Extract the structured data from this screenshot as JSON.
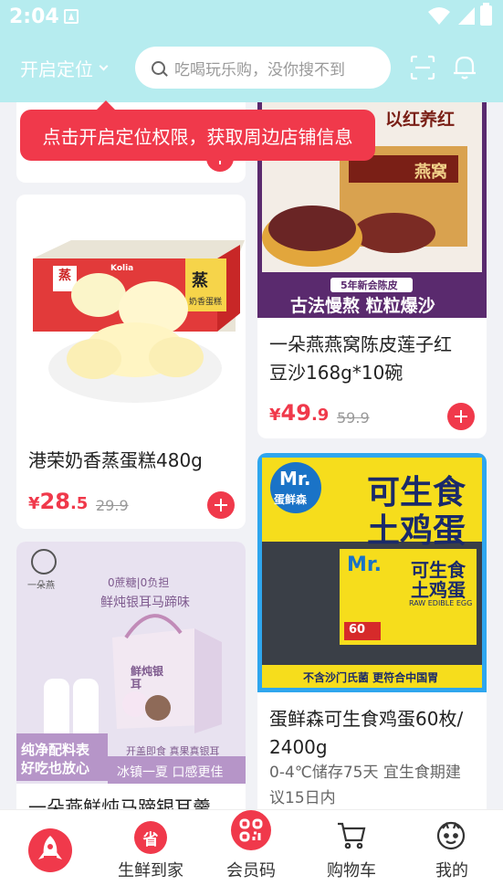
{
  "status_bar": {
    "time": "2:04"
  },
  "header": {
    "location_label": "开启定位",
    "search_placeholder": "吃喝玩乐购，没你搜不到"
  },
  "tooltip": {
    "text": "点击开启定位权限，获取周边店铺信息"
  },
  "products": [
    {
      "image_text": [
        "蒸",
        "奶香蛋糕",
        "Kolia"
      ],
      "title": "港荣奶香蒸蛋糕480g",
      "price_currency": "¥",
      "price_int": "28",
      "price_dec": ".5",
      "old_price": "29.9"
    },
    {
      "image_text": [
        "一朵燕",
        "0蔗糖|0负担",
        "鲜炖银耳马蹄味",
        "纯净配料表",
        "好吃也放心",
        "开盖即食 真果真银耳",
        "冰镇一夏 口感更佳",
        "鲜炖银耳"
      ],
      "title": "一朵燕鲜炖马蹄银耳羹"
    },
    {
      "image_text": [
        "以红养红",
        "燕窝",
        "5年新会陈皮",
        "古法慢熬 粒粒爆沙"
      ],
      "title": "一朵燕燕窝陈皮莲子红豆沙168g*10碗",
      "title_lines": [
        "一朵燕燕窝陈皮莲子红",
        "豆沙168g*10碗"
      ],
      "price_currency": "¥",
      "price_int": "49",
      "price_dec": ".9",
      "old_price": "59.9"
    },
    {
      "image_text": [
        "Mr.",
        "蛋鲜森",
        "可生食",
        "土鸡蛋",
        "RAW EDIBLE EGG",
        "60",
        "不含沙门氏菌 更符合中国胃"
      ],
      "title_lines": [
        "蛋鲜森可生食鸡蛋60枚/",
        "2400g"
      ],
      "subtitle_lines": [
        "0-4℃储存75天 宜生食期建",
        "议15日内"
      ]
    }
  ],
  "bottom_nav": [
    {
      "label": "",
      "icon": "rocket-home-icon"
    },
    {
      "label": "生鲜到家",
      "icon": "sheng-icon",
      "glyph": "省"
    },
    {
      "label": "会员码",
      "icon": "qr-code-icon"
    },
    {
      "label": "购物车",
      "icon": "cart-icon"
    },
    {
      "label": "我的",
      "icon": "profile-icon"
    }
  ],
  "colors": {
    "header_bg": "#b6ecef",
    "accent": "#f0394b"
  }
}
